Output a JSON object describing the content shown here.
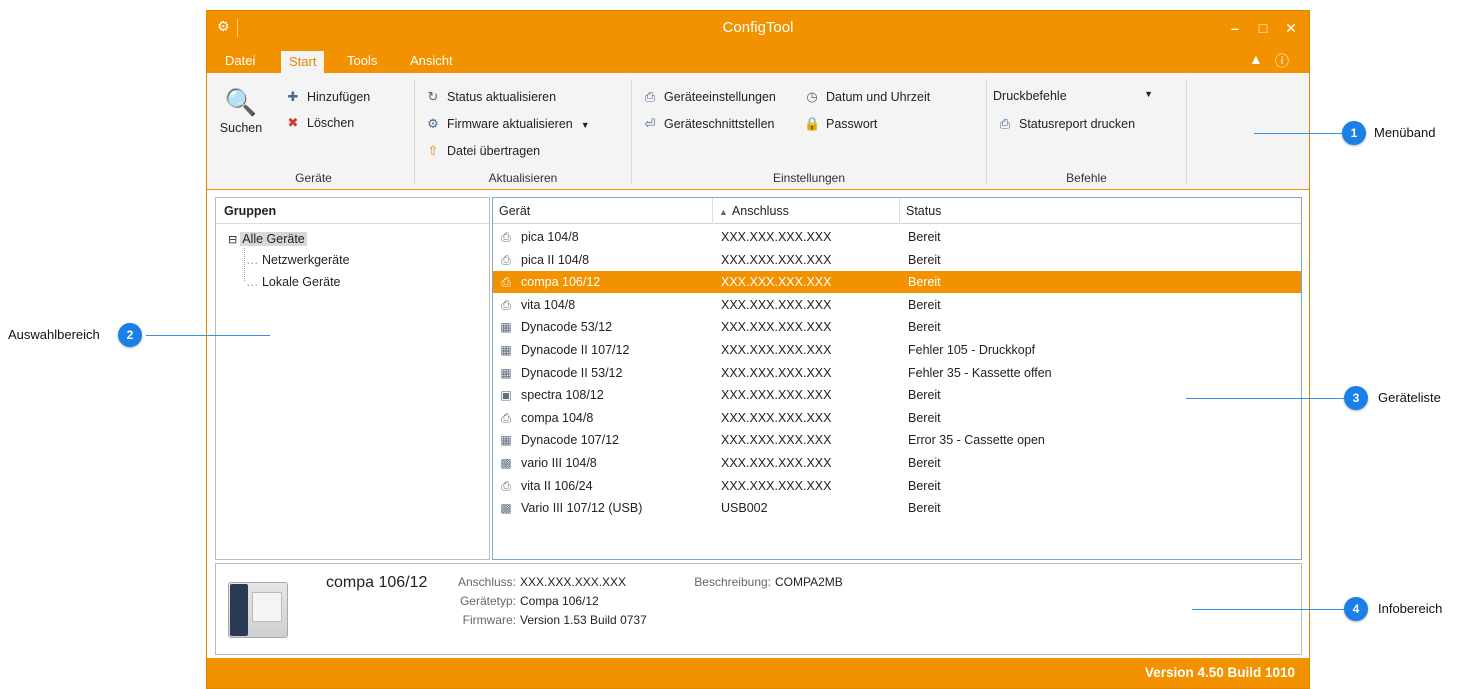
{
  "window": {
    "title": "ConfigTool"
  },
  "menu_tabs": [
    {
      "label": "Datei"
    },
    {
      "label": "Start"
    },
    {
      "label": "Tools"
    },
    {
      "label": "Ansicht"
    }
  ],
  "ribbon": {
    "geraete": {
      "label": "Geräte",
      "search": "Suchen",
      "add": "Hinzufügen",
      "delete": "Löschen"
    },
    "aktualisieren": {
      "label": "Aktualisieren",
      "status": "Status aktualisieren",
      "firmware": "Firmware aktualisieren",
      "transfer": "Datei übertragen"
    },
    "einstellungen": {
      "label": "Einstellungen",
      "device_settings": "Geräteeinstellungen",
      "date_time": "Datum und Uhrzeit",
      "interfaces": "Geräteschnittstellen",
      "password": "Passwort"
    },
    "befehle": {
      "label": "Befehle",
      "print_commands": "Druckbefehle",
      "status_report": "Statusreport drucken"
    }
  },
  "groups": {
    "header": "Gruppen",
    "root": "Alle Geräte",
    "children": [
      "Netzwerkgeräte",
      "Lokale Geräte"
    ]
  },
  "device_list": {
    "columns": [
      "Gerät",
      "Anschluss",
      "Status"
    ],
    "rows": [
      {
        "device": "pica 104/8",
        "port": "XXX.XXX.XXX.XXX",
        "status": "Bereit"
      },
      {
        "device": "pica II 104/8",
        "port": "XXX.XXX.XXX.XXX",
        "status": "Bereit"
      },
      {
        "device": "compa 106/12",
        "port": "XXX.XXX.XXX.XXX",
        "status": "Bereit",
        "selected": true
      },
      {
        "device": "vita 104/8",
        "port": "XXX.XXX.XXX.XXX",
        "status": "Bereit"
      },
      {
        "device": "Dynacode 53/12",
        "port": "XXX.XXX.XXX.XXX",
        "status": "Bereit"
      },
      {
        "device": "Dynacode II 107/12",
        "port": "XXX.XXX.XXX.XXX",
        "status": "Fehler 105 - Druckkopf"
      },
      {
        "device": "Dynacode II 53/12",
        "port": "XXX.XXX.XXX.XXX",
        "status": "Fehler 35 - Kassette offen"
      },
      {
        "device": "spectra 108/12",
        "port": "XXX.XXX.XXX.XXX",
        "status": "Bereit"
      },
      {
        "device": "compa 104/8",
        "port": "XXX.XXX.XXX.XXX",
        "status": "Bereit"
      },
      {
        "device": "Dynacode 107/12",
        "port": "XXX.XXX.XXX.XXX",
        "status": "Error 35 - Cassette open"
      },
      {
        "device": "vario III 104/8",
        "port": "XXX.XXX.XXX.XXX",
        "status": "Bereit"
      },
      {
        "device": "vita II 106/24",
        "port": "XXX.XXX.XXX.XXX",
        "status": "Bereit"
      },
      {
        "device": "Vario III 107/12 (USB)",
        "port": "USB002",
        "status": "Bereit"
      }
    ]
  },
  "info": {
    "device_name": "compa 106/12",
    "port_label": "Anschluss:",
    "port_value": "XXX.XXX.XXX.XXX",
    "type_label": "Gerätetyp:",
    "type_value": "Compa 106/12",
    "firmware_label": "Firmware:",
    "firmware_value": "Version 1.53 Build 0737",
    "desc_label": "Beschreibung:",
    "desc_value": "COMPA2MB"
  },
  "statusbar": {
    "version": "Version 4.50 Build 1010"
  },
  "callouts": [
    {
      "number": "1",
      "label": "Menüband"
    },
    {
      "number": "2",
      "label": "Auswahlbereich"
    },
    {
      "number": "3",
      "label": "Geräteliste"
    },
    {
      "number": "4",
      "label": "Infobereich"
    }
  ],
  "colors": {
    "accent": "#f39200",
    "callout": "#1a7fe6"
  }
}
